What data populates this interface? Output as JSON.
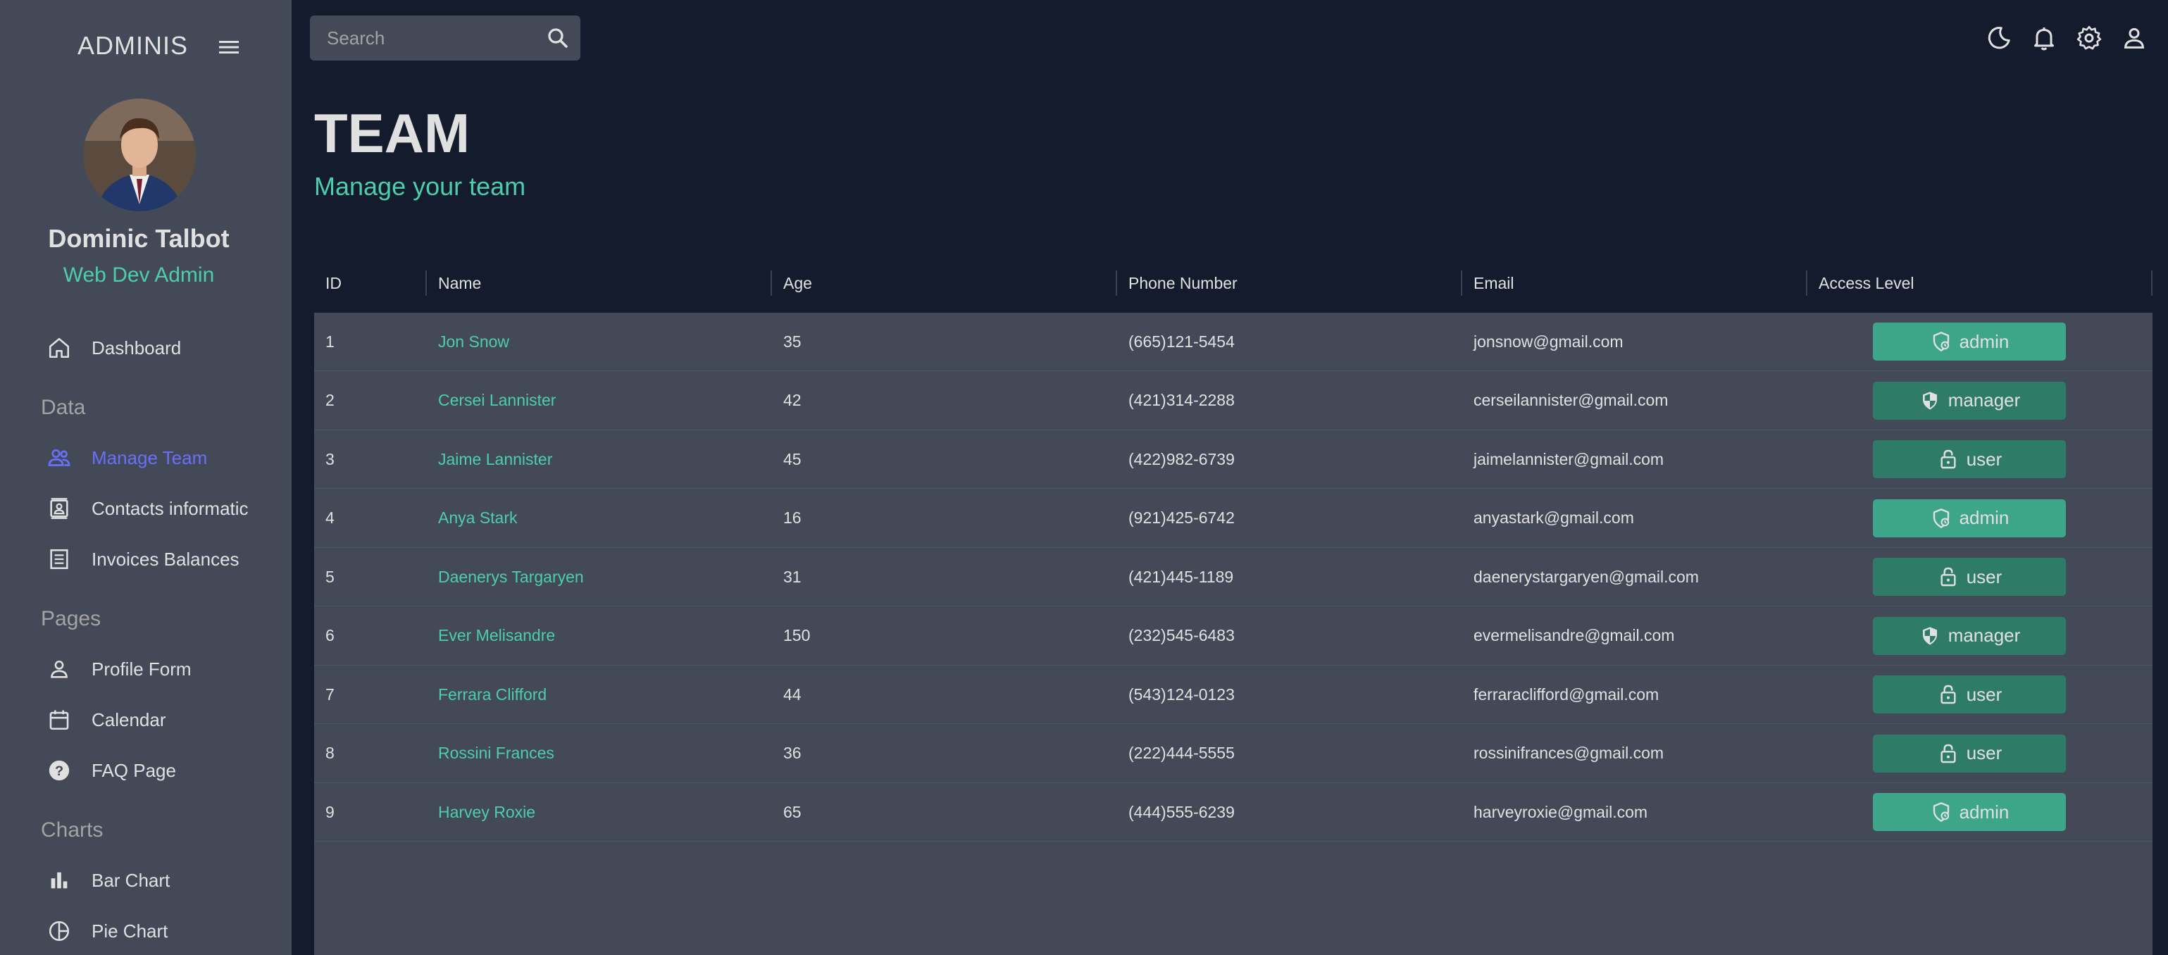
{
  "sidebar": {
    "brand": "ADMINIS",
    "user": {
      "name": "Dominic Talbot",
      "role": "Web Dev Admin"
    },
    "items": [
      {
        "label": "Dashboard",
        "icon": "home-icon"
      },
      {
        "section": "Data"
      },
      {
        "label": "Manage Team",
        "icon": "people-icon",
        "active": true
      },
      {
        "label": "Contacts informatic",
        "icon": "contacts-icon"
      },
      {
        "label": "Invoices Balances",
        "icon": "receipt-icon"
      },
      {
        "section": "Pages"
      },
      {
        "label": "Profile Form",
        "icon": "person-icon"
      },
      {
        "label": "Calendar",
        "icon": "calendar-icon"
      },
      {
        "label": "FAQ Page",
        "icon": "help-icon"
      },
      {
        "section": "Charts"
      },
      {
        "label": "Bar Chart",
        "icon": "bar-chart-icon"
      },
      {
        "label": "Pie Chart",
        "icon": "pie-chart-icon"
      }
    ]
  },
  "topbar": {
    "search_placeholder": "Search",
    "icons": [
      "dark-mode-icon",
      "notifications-icon",
      "settings-icon",
      "profile-icon"
    ]
  },
  "header": {
    "title": "TEAM",
    "subtitle": "Manage your team"
  },
  "table": {
    "columns": [
      "ID",
      "Name",
      "Age",
      "Phone Number",
      "Email",
      "Access Level"
    ],
    "rows": [
      {
        "id": "1",
        "name": "Jon Snow",
        "age": "35",
        "phone": "(665)121-5454",
        "email": "jonsnow@gmail.com",
        "access": "admin"
      },
      {
        "id": "2",
        "name": "Cersei Lannister",
        "age": "42",
        "phone": "(421)314-2288",
        "email": "cerseilannister@gmail.com",
        "access": "manager"
      },
      {
        "id": "3",
        "name": "Jaime Lannister",
        "age": "45",
        "phone": "(422)982-6739",
        "email": "jaimelannister@gmail.com",
        "access": "user"
      },
      {
        "id": "4",
        "name": "Anya Stark",
        "age": "16",
        "phone": "(921)425-6742",
        "email": "anyastark@gmail.com",
        "access": "admin"
      },
      {
        "id": "5",
        "name": "Daenerys Targaryen",
        "age": "31",
        "phone": "(421)445-1189",
        "email": "daenerystargaryen@gmail.com",
        "access": "user"
      },
      {
        "id": "6",
        "name": "Ever Melisandre",
        "age": "150",
        "phone": "(232)545-6483",
        "email": "evermelisandre@gmail.com",
        "access": "manager"
      },
      {
        "id": "7",
        "name": "Ferrara Clifford",
        "age": "44",
        "phone": "(543)124-0123",
        "email": "ferraraclifford@gmail.com",
        "access": "user"
      },
      {
        "id": "8",
        "name": "Rossini Frances",
        "age": "36",
        "phone": "(222)444-5555",
        "email": "rossinifrances@gmail.com",
        "access": "user"
      },
      {
        "id": "9",
        "name": "Harvey Roxie",
        "age": "65",
        "phone": "(444)555-6239",
        "email": "harveyroxie@gmail.com",
        "access": "admin"
      }
    ]
  },
  "colors": {
    "background": "#141b2d",
    "sidebar": "#434957",
    "accent_green": "#4cceac",
    "active_nav": "#6870fa",
    "admin_button": "#3da58a",
    "other_button": "#2e7c67"
  }
}
